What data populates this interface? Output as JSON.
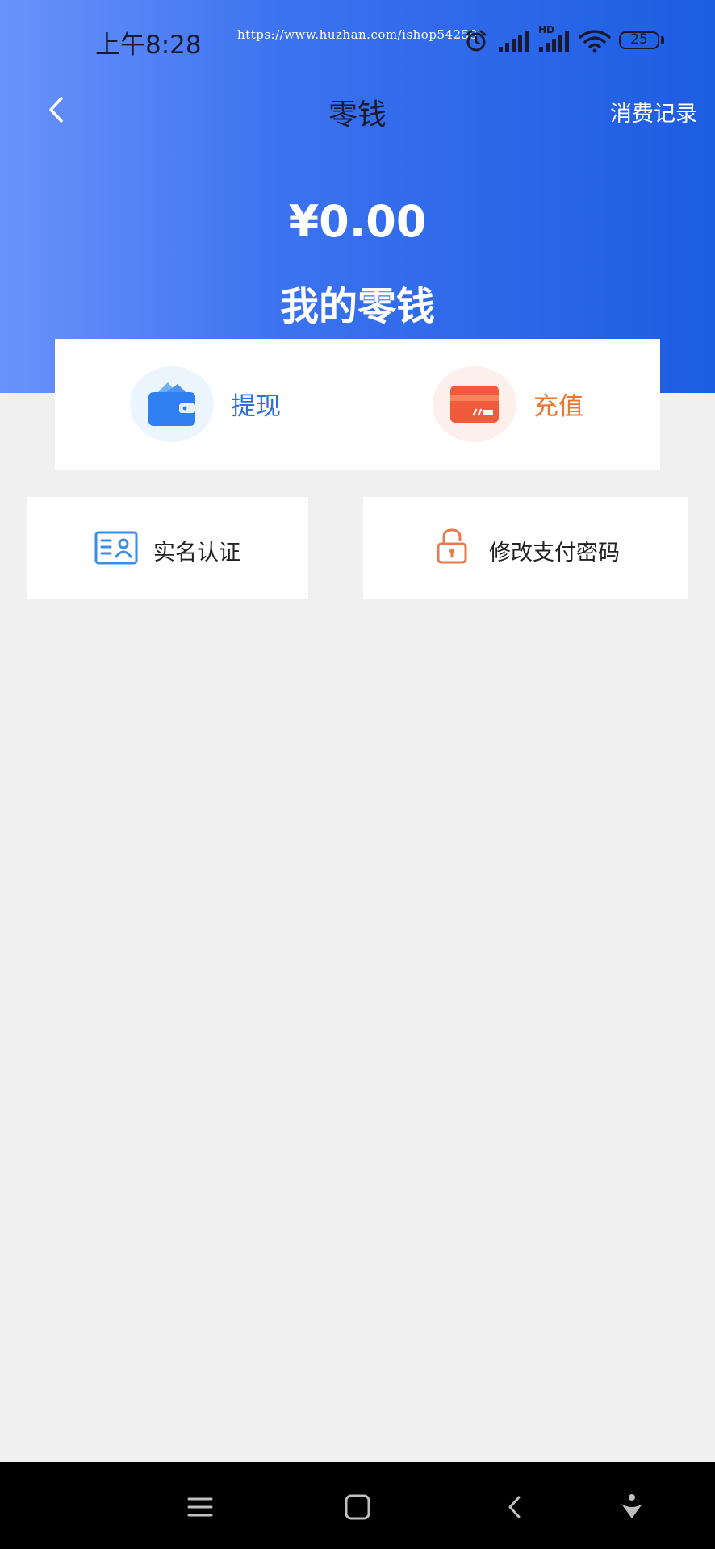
{
  "status_bar": {
    "time": "上午8:28",
    "watermark_url": "https://www.huzhan.com/ishop54250",
    "network_label": "HD",
    "battery": "25",
    "icons": [
      "alarm-icon",
      "signal-icon",
      "signal-hd-icon",
      "wifi-icon",
      "battery-icon"
    ]
  },
  "header": {
    "back_icon": "chevron-left-icon",
    "title": "零钱",
    "records_link": "消费记录"
  },
  "balance": {
    "amount": "¥0.00",
    "label": "我的零钱"
  },
  "actions": [
    {
      "label": "提现",
      "icon": "wallet-icon",
      "color": "#2a6fdc"
    },
    {
      "label": "充值",
      "icon": "card-icon",
      "color": "#ed7532"
    }
  ],
  "tiles": [
    {
      "label": "实名认证",
      "icon": "id-card-icon",
      "color": "#3a8ee6"
    },
    {
      "label": "修改支付密码",
      "icon": "lock-icon",
      "color": "#e57a4e"
    }
  ],
  "colors": {
    "header_gradient_start": "#6a93fb",
    "header_gradient_end": "#1d5de2",
    "page_background": "#f0f0f0"
  },
  "nav_bar": [
    "menu-icon",
    "home-icon",
    "back-icon",
    "assistant-icon"
  ]
}
